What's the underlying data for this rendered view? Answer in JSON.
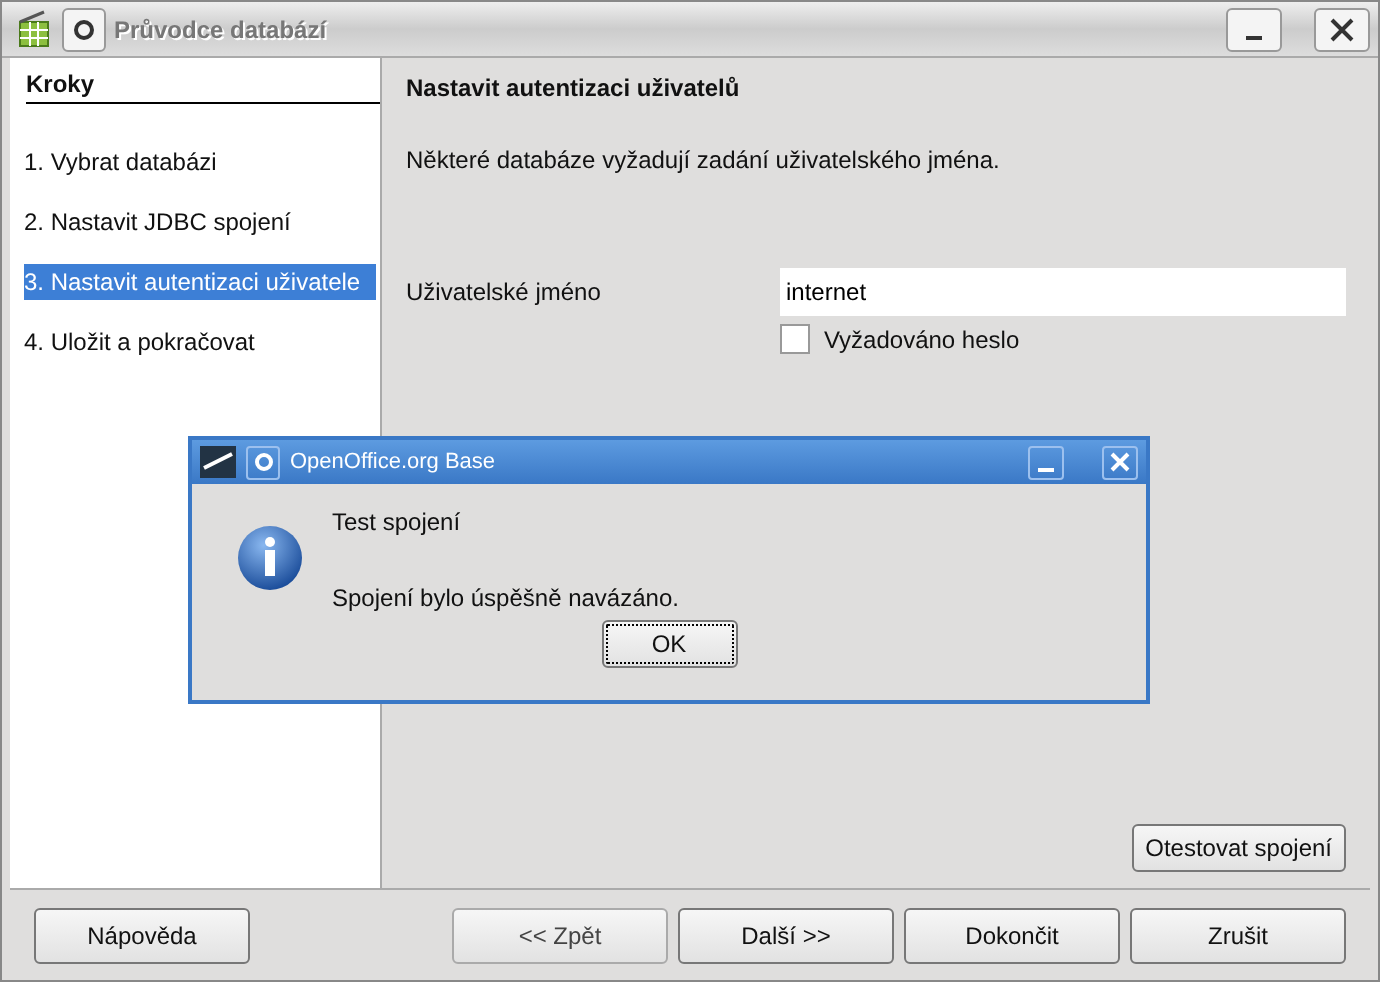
{
  "window": {
    "title": "Průvodce databází"
  },
  "steps": {
    "title": "Kroky",
    "items": [
      {
        "label": "1. Vybrat databázi",
        "selected": false
      },
      {
        "label": "2. Nastavit JDBC spojení",
        "selected": false
      },
      {
        "label": "3. Nastavit autentizaci uživatele",
        "selected": true
      },
      {
        "label": "4. Uložit a pokračovat",
        "selected": false
      }
    ]
  },
  "page": {
    "heading": "Nastavit autentizaci uživatelů",
    "description": "Některé databáze vyžadují zadání uživatelského jména.",
    "username_label": "Uživatelské jméno",
    "username_value": "internet",
    "password_required": {
      "label": "Vyžadováno heslo",
      "checked": false
    },
    "test_button": "Otestovat spojení"
  },
  "buttons": [
    {
      "label": "Nápověda",
      "disabled": false
    },
    {
      "label": "<< Zpět",
      "disabled": true
    },
    {
      "label": "Další >>",
      "disabled": false
    },
    {
      "label": "Dokončit",
      "disabled": false
    },
    {
      "label": "Zrušit",
      "disabled": false
    }
  ],
  "dialog": {
    "title": "OpenOffice.org Base",
    "heading": "Test spojení",
    "message": "Spojení bylo úspěšně navázáno.",
    "button": "OK"
  }
}
